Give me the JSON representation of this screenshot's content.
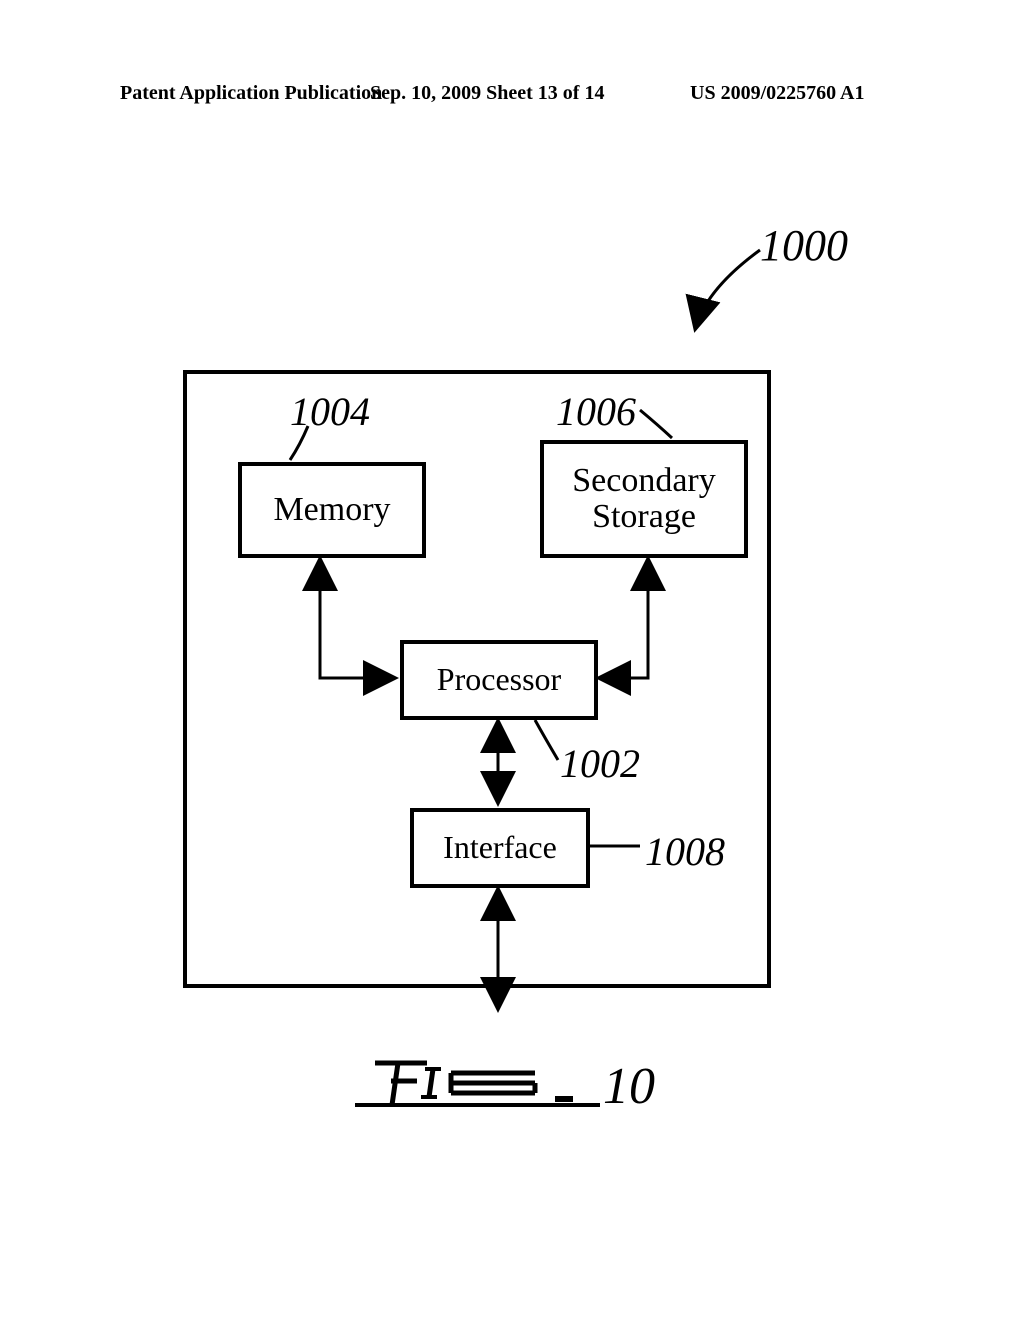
{
  "header": {
    "left": "Patent Application Publication",
    "mid": "Sep. 10, 2009  Sheet 13 of 14",
    "right": "US 2009/0225760 A1"
  },
  "refs": {
    "system": "1000",
    "memory": "1004",
    "secondary": "1006",
    "processor": "1002",
    "interface": "1008"
  },
  "blocks": {
    "memory": "Memory",
    "secondary": "Secondary\nStorage",
    "processor": "Processor",
    "interface": "Interface"
  },
  "figure": {
    "label": "FIG. 10"
  }
}
